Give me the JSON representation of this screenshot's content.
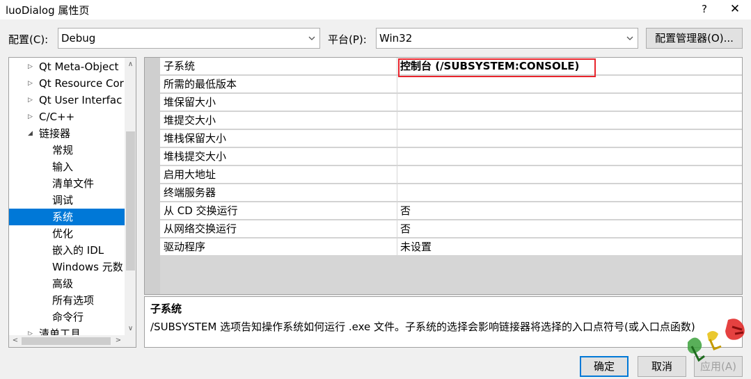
{
  "window": {
    "title": "luoDialog 属性页",
    "help_glyph": "?",
    "close_glyph": "✕"
  },
  "toolbar": {
    "config_label": "配置(C):",
    "config_value": "Debug",
    "platform_label": "平台(P):",
    "platform_value": "Win32",
    "manager_label": "配置管理器(O)..."
  },
  "tree": {
    "items": [
      {
        "label": "Qt Meta-Object",
        "expander": "▷",
        "level": 0
      },
      {
        "label": "Qt Resource Cor",
        "expander": "▷",
        "level": 0
      },
      {
        "label": "Qt User Interfac",
        "expander": "▷",
        "level": 0
      },
      {
        "label": "C/C++",
        "expander": "▷",
        "level": 0
      },
      {
        "label": "链接器",
        "expander": "◢",
        "level": 0
      },
      {
        "label": "常规",
        "expander": "",
        "level": 1
      },
      {
        "label": "输入",
        "expander": "",
        "level": 1
      },
      {
        "label": "清单文件",
        "expander": "",
        "level": 1
      },
      {
        "label": "调试",
        "expander": "",
        "level": 1
      },
      {
        "label": "系统",
        "expander": "",
        "level": 1,
        "selected": true
      },
      {
        "label": "优化",
        "expander": "",
        "level": 1
      },
      {
        "label": "嵌入的 IDL",
        "expander": "",
        "level": 1
      },
      {
        "label": "Windows 元数",
        "expander": "",
        "level": 1
      },
      {
        "label": "高级",
        "expander": "",
        "level": 1
      },
      {
        "label": "所有选项",
        "expander": "",
        "level": 1
      },
      {
        "label": "命令行",
        "expander": "",
        "level": 1
      },
      {
        "label": "清单工具",
        "expander": "▷",
        "level": 0
      }
    ]
  },
  "properties": {
    "rows": [
      {
        "name": "子系统",
        "value": "控制台 (/SUBSYSTEM:CONSOLE)"
      },
      {
        "name": "所需的最低版本",
        "value": ""
      },
      {
        "name": "堆保留大小",
        "value": ""
      },
      {
        "name": "堆提交大小",
        "value": ""
      },
      {
        "name": "堆栈保留大小",
        "value": ""
      },
      {
        "name": "堆栈提交大小",
        "value": ""
      },
      {
        "name": "启用大地址",
        "value": ""
      },
      {
        "name": "终端服务器",
        "value": ""
      },
      {
        "name": "从 CD 交换运行",
        "value": "否"
      },
      {
        "name": "从网络交换运行",
        "value": "否"
      },
      {
        "name": "驱动程序",
        "value": "未设置"
      }
    ]
  },
  "description": {
    "title": "子系统",
    "text": "/SUBSYSTEM 选项告知操作系统如何运行 .exe 文件。子系统的选择会影响链接器将选择的入口点符号(或入口点函数)"
  },
  "buttons": {
    "ok": "确定",
    "cancel": "取消",
    "apply": "应用(A)"
  },
  "colors": {
    "selection": "#0078d7",
    "highlight_border": "#e8242c"
  }
}
